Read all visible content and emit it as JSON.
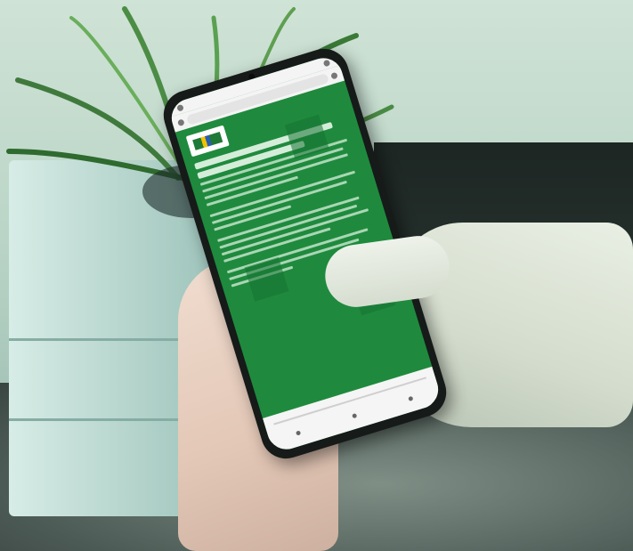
{
  "scene": {
    "description_icon": "photo-icon"
  },
  "colors": {
    "screen_green": "#1f8a3d",
    "phone_body": "#161a19",
    "browser_chrome": "#f4f4f4"
  },
  "phone_screen": {
    "text_lines": 14,
    "logo_icon": "government-logo-icon"
  }
}
